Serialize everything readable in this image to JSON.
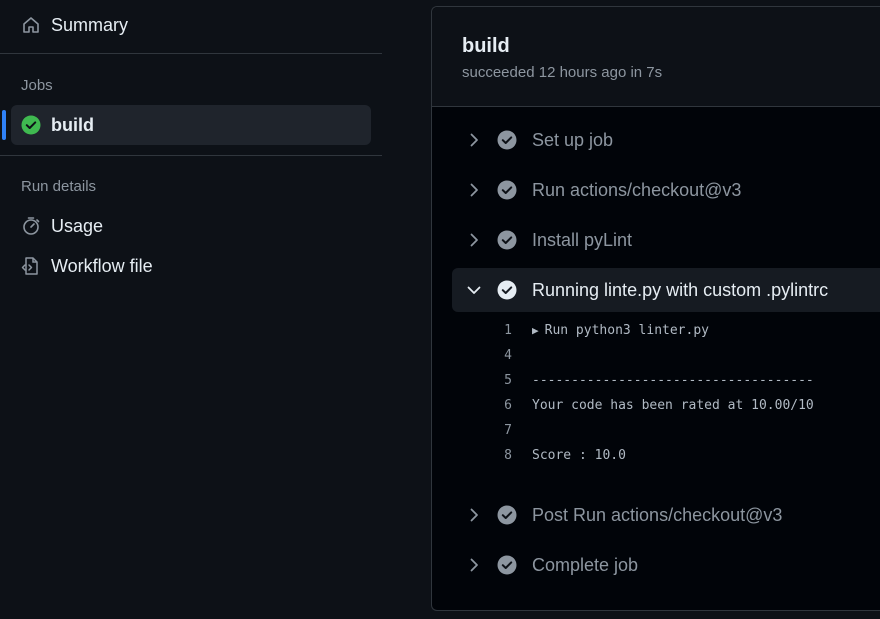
{
  "sidebar": {
    "summary_label": "Summary",
    "jobs_title": "Jobs",
    "job": {
      "label": "build",
      "status": "success"
    },
    "run_details_title": "Run details",
    "usage_label": "Usage",
    "workflow_label": "Workflow file"
  },
  "job": {
    "title": "build",
    "subtitle": "succeeded 12 hours ago in 7s"
  },
  "steps": [
    {
      "name": "Set up job",
      "expanded": false
    },
    {
      "name": "Run actions/checkout@v3",
      "expanded": false
    },
    {
      "name": "Install pyLint",
      "expanded": false
    },
    {
      "name": "Running linte.py with custom .pylintrc",
      "expanded": true
    },
    {
      "name": "Post Run actions/checkout@v3",
      "expanded": false
    },
    {
      "name": "Complete job",
      "expanded": false
    }
  ],
  "log": [
    {
      "num": "1",
      "text": "Run python3 linter.py",
      "collapsible": true
    },
    {
      "num": "4",
      "text": ""
    },
    {
      "num": "5",
      "text": "------------------------------------"
    },
    {
      "num": "6",
      "text": "Your code has been rated at 10.00/10"
    },
    {
      "num": "7",
      "text": ""
    },
    {
      "num": "8",
      "text": "Score : 10.0"
    }
  ],
  "colors": {
    "success": "#3fb950",
    "accent": "#2f81f7",
    "muted": "#8d96a0",
    "background": "#0d1117"
  }
}
